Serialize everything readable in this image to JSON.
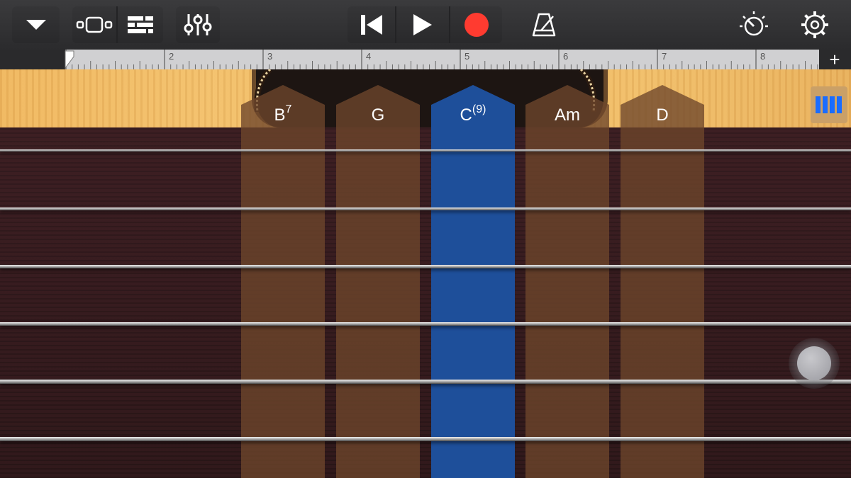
{
  "toolbar": {
    "buttons": [
      {
        "name": "menu-dropdown",
        "icon": "triangle-down-icon"
      },
      {
        "name": "instrument-browser",
        "icon": "browser-icon"
      },
      {
        "name": "tracks-view",
        "icon": "tracks-icon"
      },
      {
        "name": "mixer",
        "icon": "sliders-icon"
      },
      {
        "name": "go-to-beginning",
        "icon": "skip-back-icon"
      },
      {
        "name": "play",
        "icon": "play-icon"
      },
      {
        "name": "record",
        "icon": "record-icon",
        "color": "#ff3b30"
      },
      {
        "name": "metronome",
        "icon": "metronome-icon"
      },
      {
        "name": "master-effects",
        "icon": "knob-icon"
      },
      {
        "name": "settings",
        "icon": "gear-icon"
      }
    ]
  },
  "ruler": {
    "bars": [
      "2",
      "3",
      "4",
      "5",
      "6",
      "7",
      "8"
    ],
    "add_section_label": "+"
  },
  "chords": [
    {
      "root": "B",
      "ext": "7",
      "active": false
    },
    {
      "root": "G",
      "ext": "",
      "active": false
    },
    {
      "root": "C",
      "ext": "(9)",
      "active": true
    },
    {
      "root": "Am",
      "ext": "",
      "active": false
    },
    {
      "root": "D",
      "ext": "",
      "active": false
    }
  ],
  "strings_count": 6,
  "colors": {
    "active_chord": "#1e4f9a",
    "inactive_chord": "#6e462c",
    "record": "#ff3b30",
    "view_toggle_icon": "#1a6cff"
  },
  "side_controls": {
    "view_toggle_icon": "chords-notes-toggle-icon",
    "joystick": "autoplay-knob"
  }
}
